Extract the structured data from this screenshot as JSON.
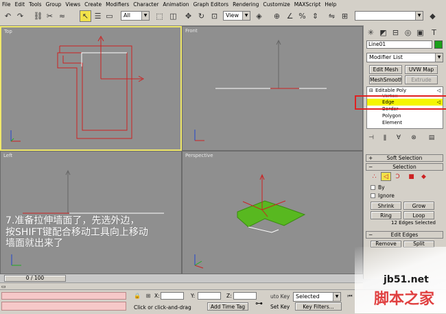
{
  "menu": [
    "File",
    "Edit",
    "Tools",
    "Group",
    "Views",
    "Create",
    "Modifiers",
    "Character",
    "Animation",
    "Graph Editors",
    "Rendering",
    "Customize",
    "MAXScript",
    "Help"
  ],
  "toolbar": {
    "filter": "All",
    "refcoord": "View"
  },
  "viewports": {
    "top": "Top",
    "front": "Front",
    "left": "Left",
    "perspective": "Perspective"
  },
  "annotation": [
    "7.准备拉伸墙面了，先选外边，",
    "按SHIFT键配合移动工具向上移动",
    "墙面就出来了"
  ],
  "command_panel": {
    "object_name": "Line01",
    "object_color": "#1aa01a",
    "modifier_list": "Modifier List",
    "buttons": [
      "Edit Mesh",
      "UVW Map",
      "MeshSmooth",
      "Extrude"
    ],
    "stack": {
      "base": "Editable Poly",
      "items": [
        "Vertex",
        "Edge",
        "Border",
        "Polygon",
        "Element"
      ],
      "selected": "Edge"
    },
    "rollouts": {
      "soft_selection": "Soft Selection",
      "selection": "Selection",
      "edit_edges": "Edit Edges"
    },
    "selection": {
      "by_label": "By",
      "ignore_label": "Ignore",
      "shrink": "Shrink",
      "grow": "Grow",
      "ring": "Ring",
      "loop": "Loop",
      "status": "12 Edges Selected"
    },
    "edit_edges": {
      "remove": "Remove",
      "split": "Split"
    }
  },
  "timeline": {
    "frame": "0 / 100"
  },
  "status": {
    "prompt": "Click or click-and-drag",
    "add_time_tag": "Add Time Tag",
    "x_label": "X:",
    "y_label": "Y:",
    "z_label": "Z:",
    "auto_key": "uto Key",
    "selected": "Selected",
    "set_key": "Set Key",
    "key_filters": "Key Filters..."
  },
  "watermark": {
    "site": "jb51.net",
    "name": "脚本之家"
  },
  "colors": {
    "highlight": "#f0e86a",
    "shape": "#cc2222",
    "mesh": "#58b820",
    "annotation_box": "#e02020"
  }
}
